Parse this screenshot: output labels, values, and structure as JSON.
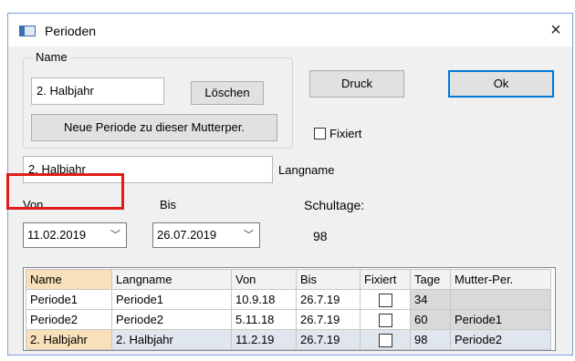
{
  "window": {
    "title": "Perioden",
    "close_glyph": "×"
  },
  "name_group": {
    "label": "Name",
    "name_value": "2. Halbjahr",
    "delete_label": "Löschen",
    "new_period_label": "Neue Periode zu dieser Mutterper."
  },
  "buttons": {
    "print_label": "Druck",
    "ok_label": "Ok"
  },
  "fixed": {
    "label": "Fixiert",
    "checked": false
  },
  "long_name": {
    "value": "2. Halbjahr",
    "label": "Langname"
  },
  "dates": {
    "from_label": "Von",
    "from_value": "11.02.2019",
    "to_label": "Bis",
    "to_value": "26.07.2019",
    "dropdown_glyph": "﹀"
  },
  "school_days": {
    "label": "Schultage:",
    "value": "98"
  },
  "table": {
    "columns": [
      "Name",
      "Langname",
      "Von",
      "Bis",
      "Fixiert",
      "Tage",
      "Mutter-Per."
    ],
    "rows": [
      {
        "name": "Periode1",
        "langname": "Periode1",
        "von": "10.9.18",
        "bis": "26.7.19",
        "fixiert": false,
        "tage": "34",
        "mutter": ""
      },
      {
        "name": "Periode2",
        "langname": "Periode2",
        "von": "5.11.18",
        "bis": "26.7.19",
        "fixiert": false,
        "tage": "60",
        "mutter": "Periode1"
      },
      {
        "name": "2. Halbjahr",
        "langname": "2. Halbjahr",
        "von": "11.2.19",
        "bis": "26.7.19",
        "fixiert": false,
        "tage": "98",
        "mutter": "Periode2"
      }
    ]
  },
  "colors": {
    "highlight_frame": "#e21b1b",
    "active_cell": "#f7e0ba",
    "selected_row": "#dfe6ee"
  }
}
